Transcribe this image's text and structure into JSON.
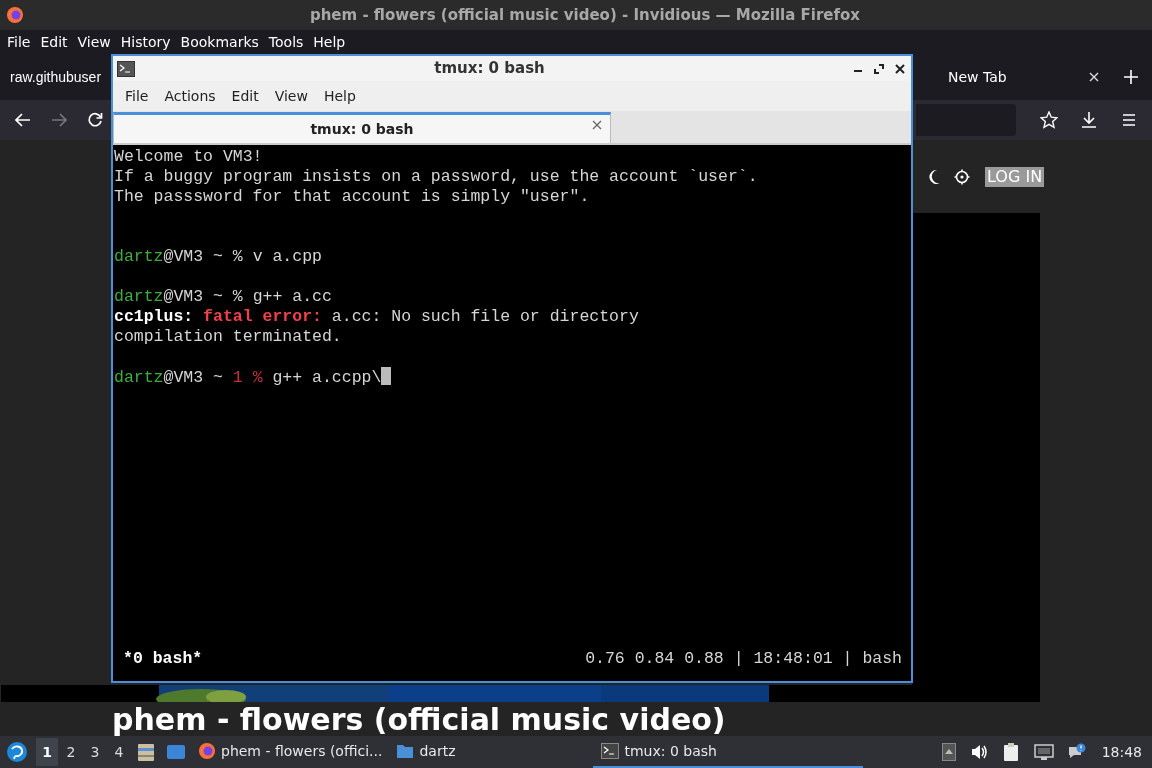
{
  "firefox": {
    "title": "phem - flowers (official music video) - Invidious — Mozilla Firefox",
    "menu": [
      "File",
      "Edit",
      "View",
      "History",
      "Bookmarks",
      "Tools",
      "Help"
    ],
    "tabs": [
      {
        "label": "raw.githubuser",
        "selected": false
      },
      {
        "label": "New Tab",
        "selected": false
      }
    ],
    "forward_disabled": true,
    "login": "LOG IN",
    "video_title": "phem - flowers (official music video)"
  },
  "terminal": {
    "title": "tmux: 0 bash",
    "menu": [
      "File",
      "Actions",
      "Edit",
      "View",
      "Help"
    ],
    "tabs": [
      {
        "label": "tmux: 0 bash",
        "selected": true
      }
    ],
    "lines": [
      {
        "kind": "text",
        "segments": [
          {
            "text": "Welcome to VM3!",
            "kind": "plain"
          }
        ]
      },
      {
        "kind": "text",
        "segments": [
          {
            "text": "If a buggy program insists on a password, use the account `user`.",
            "kind": "plain"
          }
        ]
      },
      {
        "kind": "text",
        "segments": [
          {
            "text": "The passsword for that account is simply \"user\".",
            "kind": "plain"
          }
        ]
      },
      {
        "kind": "blank"
      },
      {
        "kind": "blank"
      },
      {
        "kind": "text",
        "segments": [
          {
            "text": "dartz",
            "kind": "user"
          },
          {
            "text": "@VM3 ~ % v a.cpp",
            "kind": "plain"
          }
        ]
      },
      {
        "kind": "blank"
      },
      {
        "kind": "text",
        "segments": [
          {
            "text": "dartz",
            "kind": "user"
          },
          {
            "text": "@VM3 ~ % g++ a.cc",
            "kind": "plain"
          }
        ]
      },
      {
        "kind": "text",
        "segments": [
          {
            "text": "cc1plus:",
            "kind": "bold"
          },
          {
            "text": "fatal error:",
            "kind": "error"
          },
          {
            "text": " a.cc: No such file or directory",
            "kind": "plain"
          }
        ]
      },
      {
        "kind": "text",
        "segments": [
          {
            "text": "compilation terminated.",
            "kind": "plain"
          }
        ]
      },
      {
        "kind": "blank"
      },
      {
        "kind": "text",
        "cursor": true,
        "segments": [
          {
            "text": "dartz",
            "kind": "user"
          },
          {
            "text": "@VM3 ~ ",
            "kind": "plain"
          },
          {
            "text": "1 %",
            "kind": "code"
          },
          {
            "text": " g++ a.ccpp\\",
            "kind": "plain"
          }
        ]
      }
    ],
    "status_left": "*0 bash*",
    "status_right": "0.76 0.84 0.88 | 18:48:01 | bash"
  },
  "taskbar": {
    "workspaces": [
      {
        "label": "1",
        "selected": true
      },
      {
        "label": "2",
        "selected": false
      },
      {
        "label": "3",
        "selected": false
      },
      {
        "label": "4",
        "selected": false
      }
    ],
    "tasks": [
      {
        "kind": "browser",
        "label": "phem - flowers (offici...",
        "selected": false
      },
      {
        "kind": "folder",
        "label": "dartz",
        "selected": false
      },
      {
        "kind": "terminal",
        "label": "tmux: 0 bash",
        "selected": true
      }
    ],
    "clock": "18:48"
  }
}
